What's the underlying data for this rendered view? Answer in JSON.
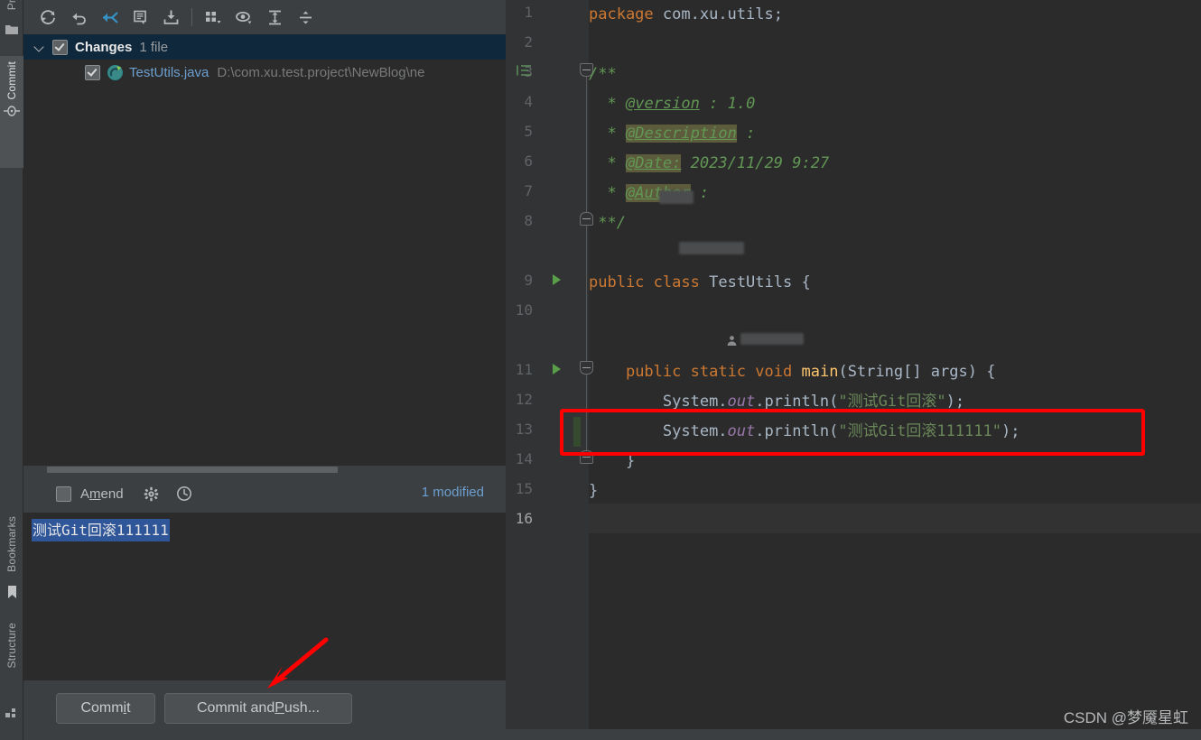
{
  "tool_window_bar": {
    "items": [
      {
        "label": "Pro",
        "icon": "folder-icon",
        "active": false
      },
      {
        "label": "Commit",
        "icon": "commit-node-icon",
        "active": true
      },
      {
        "label": "Bookmarks",
        "icon": "bookmark-icon",
        "active": false
      },
      {
        "label": "Structure",
        "icon": "structure-icon",
        "active": false
      }
    ]
  },
  "commit_panel": {
    "toolbar_buttons": [
      {
        "name": "refresh-icon",
        "tooltip": "Refresh Changes"
      },
      {
        "name": "rollback-icon",
        "tooltip": "Rollback"
      },
      {
        "name": "show-diff-icon",
        "tooltip": "Show Diff"
      },
      {
        "name": "commit-message-history-icon",
        "tooltip": "Commit Message History"
      },
      {
        "name": "update-project-icon",
        "tooltip": "Update Project"
      },
      {
        "name": "group-by-icon",
        "tooltip": "Group By"
      },
      {
        "name": "preview-diff-icon",
        "tooltip": "Preview Diff"
      },
      {
        "name": "expand-all-icon",
        "tooltip": "Expand All"
      },
      {
        "name": "collapse-all-icon",
        "tooltip": "Collapse All"
      }
    ],
    "changes_tree": {
      "header": {
        "title": "Changes",
        "count": "1 file",
        "checked": true,
        "expanded": true
      },
      "files": [
        {
          "name": "TestUtils.java",
          "path": "D:\\com.xu.test.project\\NewBlog\\ne",
          "checked": true,
          "icon": "java-class-icon"
        }
      ]
    },
    "amend": {
      "label": "Amend",
      "label_mnemonic": "m",
      "checked": false,
      "settings_icon": "gear-icon",
      "history_icon": "clock-icon"
    },
    "status": "1 modified",
    "commit_message": "测试Git回滚111111",
    "buttons": [
      {
        "id": "commit",
        "label": "Commit",
        "mnemonic": "i"
      },
      {
        "id": "commit-and-push",
        "label": "Commit and Push...",
        "mnemonic": "P"
      }
    ]
  },
  "editor": {
    "file": "TestUtils.java",
    "current_line": 16,
    "line_numbers": [
      1,
      2,
      3,
      4,
      5,
      6,
      7,
      8,
      9,
      10,
      11,
      12,
      13,
      14,
      15,
      16
    ],
    "lines": [
      {
        "n": 1,
        "text": "package com.xu.utils;"
      },
      {
        "n": 2,
        "text": ""
      },
      {
        "n": 3,
        "text": "/**"
      },
      {
        "n": 4,
        "text": " * @version : 1.0"
      },
      {
        "n": 5,
        "text": " * @Description :"
      },
      {
        "n": 6,
        "text": " * @Date: 2023/11/29 9:27"
      },
      {
        "n": 7,
        "text": " * @Author : "
      },
      {
        "n": 8,
        "text": " **/"
      },
      {
        "n": 9,
        "text": "public class TestUtils {"
      },
      {
        "n": 10,
        "text": ""
      },
      {
        "n": 11,
        "text": "    public static void main(String[] args) {"
      },
      {
        "n": 12,
        "text": "        System.out.println(\"测试Git回滚\");"
      },
      {
        "n": 13,
        "text": "        System.out.println(\"测试Git回滚111111\");"
      },
      {
        "n": 14,
        "text": "    }"
      },
      {
        "n": 15,
        "text": "}"
      },
      {
        "n": 16,
        "text": ""
      }
    ],
    "tokens": {
      "package_kw": "package",
      "package_name": "com.xu.utils;",
      "doc_open": "/**",
      "doc_star": "*",
      "tag_version": "@version",
      "version_sep": ":",
      "version_value": "1.0",
      "tag_description": "@Description",
      "description_sep": ":",
      "tag_date": "@Date:",
      "date_value": "2023/11/29 9:27",
      "tag_author": "@Author",
      "author_sep": ":",
      "doc_close": "**/",
      "public_kw": "public",
      "class_kw": "class",
      "class_name": "TestUtils",
      "brace_open": "{",
      "static_kw": "static",
      "void_kw": "void",
      "main_fn": "main",
      "main_params": "(String[] args) {",
      "system": "System.",
      "out_field": "out",
      "println": ".println(",
      "str12": "\"测试Git回滚\"",
      "str13": "\"测试Git回滚111111\"",
      "close_stmt": ");",
      "brace_close_inner": "}",
      "brace_close_outer": "}"
    },
    "colors": {
      "background": "#2b2b2b",
      "gutter": "#313335",
      "keyword": "#cc7832",
      "string": "#6a8759",
      "comment": "#629755",
      "field": "#9876aa",
      "method": "#ffc66d",
      "default_text": "#a9b7c6",
      "line_number": "#606366",
      "current_line": "#323232",
      "doc_highlight": "#5c5b3c",
      "change_marker": "#354a2f"
    },
    "annotations": [
      {
        "type": "red-rectangle",
        "target_line": 13
      },
      {
        "type": "red-arrow",
        "points_to": "commit-and-push-button"
      }
    ]
  },
  "watermark": "CSDN @梦魇星虹"
}
